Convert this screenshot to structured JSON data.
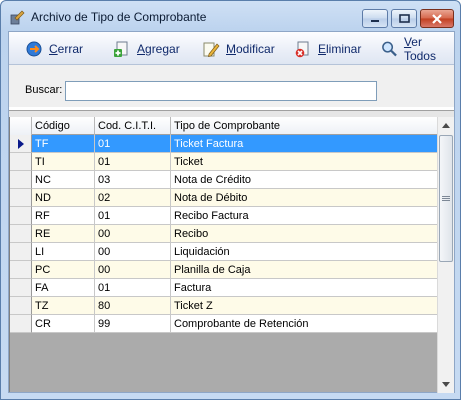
{
  "window": {
    "title": "Archivo de  Tipo de Comprobante",
    "minimize_glyph": "–",
    "maximize_glyph": "□",
    "close_glyph": "✕"
  },
  "toolbar": {
    "cerrar": "Cerrar",
    "agregar": "Agregar",
    "modificar": "Modificar",
    "eliminar": "Eliminar",
    "ver_todos": "Ver Todos"
  },
  "search": {
    "label": "Buscar:",
    "value": ""
  },
  "grid": {
    "columns": [
      "Código",
      "Cod. C.I.T.I.",
      "Tipo de Comprobante"
    ],
    "selected_row": 0,
    "rows": [
      [
        "TF",
        "01",
        "Ticket Factura"
      ],
      [
        "TI",
        "01",
        "Ticket"
      ],
      [
        "NC",
        "03",
        "Nota de Crédito"
      ],
      [
        "ND",
        "02",
        "Nota de Débito"
      ],
      [
        "RF",
        "01",
        "Recibo Factura"
      ],
      [
        "RE",
        "00",
        "Recibo"
      ],
      [
        "LI",
        "00",
        "Liquidación"
      ],
      [
        "PC",
        "00",
        "Planilla de Caja"
      ],
      [
        "FA",
        "01",
        "Factura"
      ],
      [
        "TZ",
        "80",
        "Ticket Z"
      ],
      [
        "CR",
        "99",
        "Comprobante de Retención"
      ]
    ]
  },
  "icons": {
    "app": "app-icon",
    "cerrar": "exit-icon",
    "agregar": "add-document-icon",
    "modificar": "edit-pencil-icon",
    "eliminar": "delete-document-icon",
    "ver_todos": "magnifier-icon"
  },
  "colors": {
    "selection": "#3399ff",
    "alt_row": "#fefbe8",
    "toolbar_text": "#102a6b"
  }
}
